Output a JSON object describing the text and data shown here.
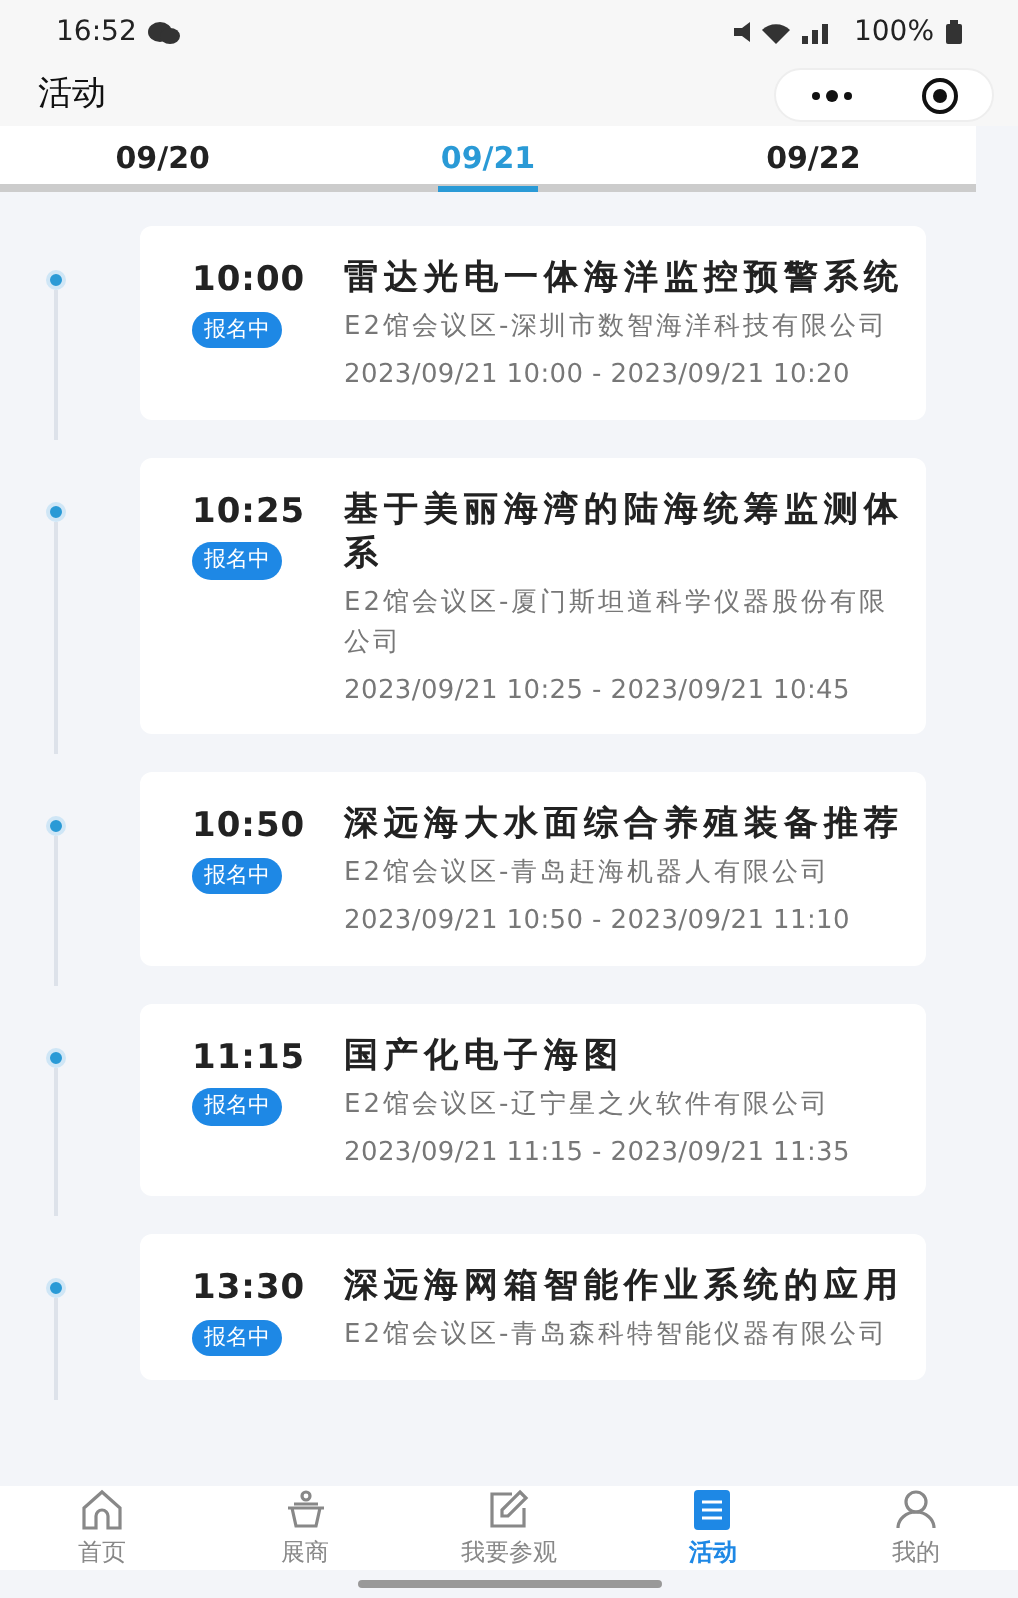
{
  "status_bar": {
    "time": "16:52",
    "battery": "100%"
  },
  "header": {
    "title": "活动"
  },
  "tabs": [
    {
      "label": "09/20",
      "selected": false
    },
    {
      "label": "09/21",
      "selected": true
    },
    {
      "label": "09/22",
      "selected": false
    }
  ],
  "events": [
    {
      "time": "10:00",
      "badge": "报名中",
      "title": "雷达光电一体海洋监控预警系统",
      "venue": "E2馆会议区-深圳市数智海洋科技有限公司",
      "range": "2023/09/21 10:00 - 2023/09/21 10:20"
    },
    {
      "time": "10:25",
      "badge": "报名中",
      "title": "基于美丽海湾的陆海统筹监测体系",
      "venue": "E2馆会议区-厦门斯坦道科学仪器股份有限公司",
      "range": "2023/09/21 10:25 - 2023/09/21 10:45"
    },
    {
      "time": "10:50",
      "badge": "报名中",
      "title": "深远海大水面综合养殖装备推荐",
      "venue": "E2馆会议区-青岛赶海机器人有限公司",
      "range": "2023/09/21 10:50 - 2023/09/21 11:10"
    },
    {
      "time": "11:15",
      "badge": "报名中",
      "title": "国产化电子海图",
      "venue": "E2馆会议区-辽宁星之火软件有限公司",
      "range": "2023/09/21 11:15 - 2023/09/21 11:35"
    },
    {
      "time": "13:30",
      "badge": "报名中",
      "title": "深远海网箱智能作业系统的应用",
      "venue": "E2馆会议区-青岛森科特智能仪器有限公司"
    }
  ],
  "nav": [
    {
      "label": "首页",
      "kind": "home",
      "selected": false
    },
    {
      "label": "展商",
      "kind": "basket",
      "selected": false
    },
    {
      "label": "我要参观",
      "kind": "edit",
      "selected": false
    },
    {
      "label": "活动",
      "kind": "list",
      "selected": true
    },
    {
      "label": "我的",
      "kind": "user",
      "selected": false
    }
  ]
}
